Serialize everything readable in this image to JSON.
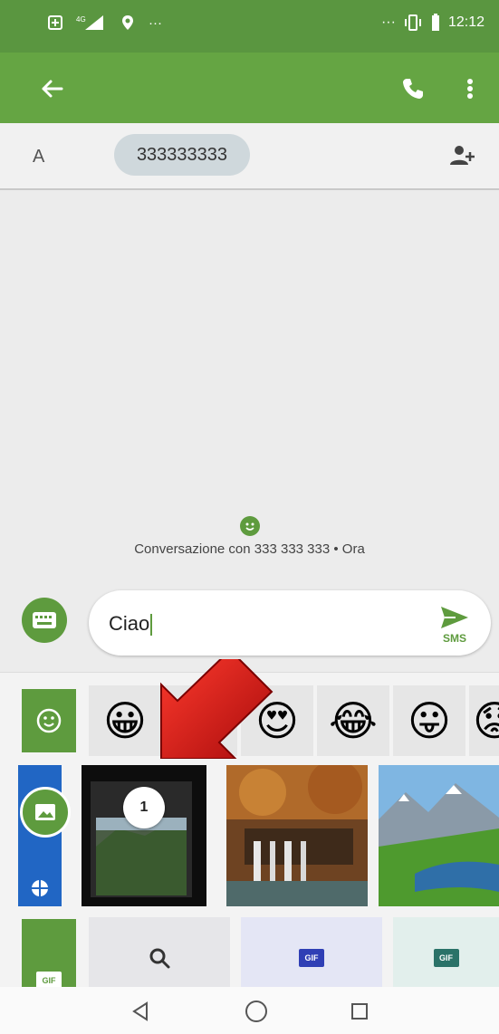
{
  "status_bar": {
    "network": "4G",
    "overflow": "···",
    "time": "12:12"
  },
  "app_bar": {
    "back_icon": "arrow-back-icon",
    "call_icon": "phone-icon",
    "more_icon": "more-vert-icon",
    "background": "#65a543"
  },
  "recipient": {
    "to_label": "A",
    "chip_text": "333333333",
    "add_icon": "add-person-icon"
  },
  "conversation": {
    "info_text": "Conversazione con 333 333 333 • Ora"
  },
  "compose": {
    "message_text": "Ciao",
    "send_label": "SMS",
    "accent": "#5e9b3e"
  },
  "picker": {
    "emojis": [
      "😀",
      "😘",
      "😍",
      "😂",
      "😛",
      "😟"
    ],
    "selected_count": "1",
    "gif_badge": "GIF"
  },
  "nav_bar": {
    "back_icon": "nav-back-icon",
    "home_icon": "nav-home-icon",
    "recents_icon": "nav-recents-icon"
  }
}
